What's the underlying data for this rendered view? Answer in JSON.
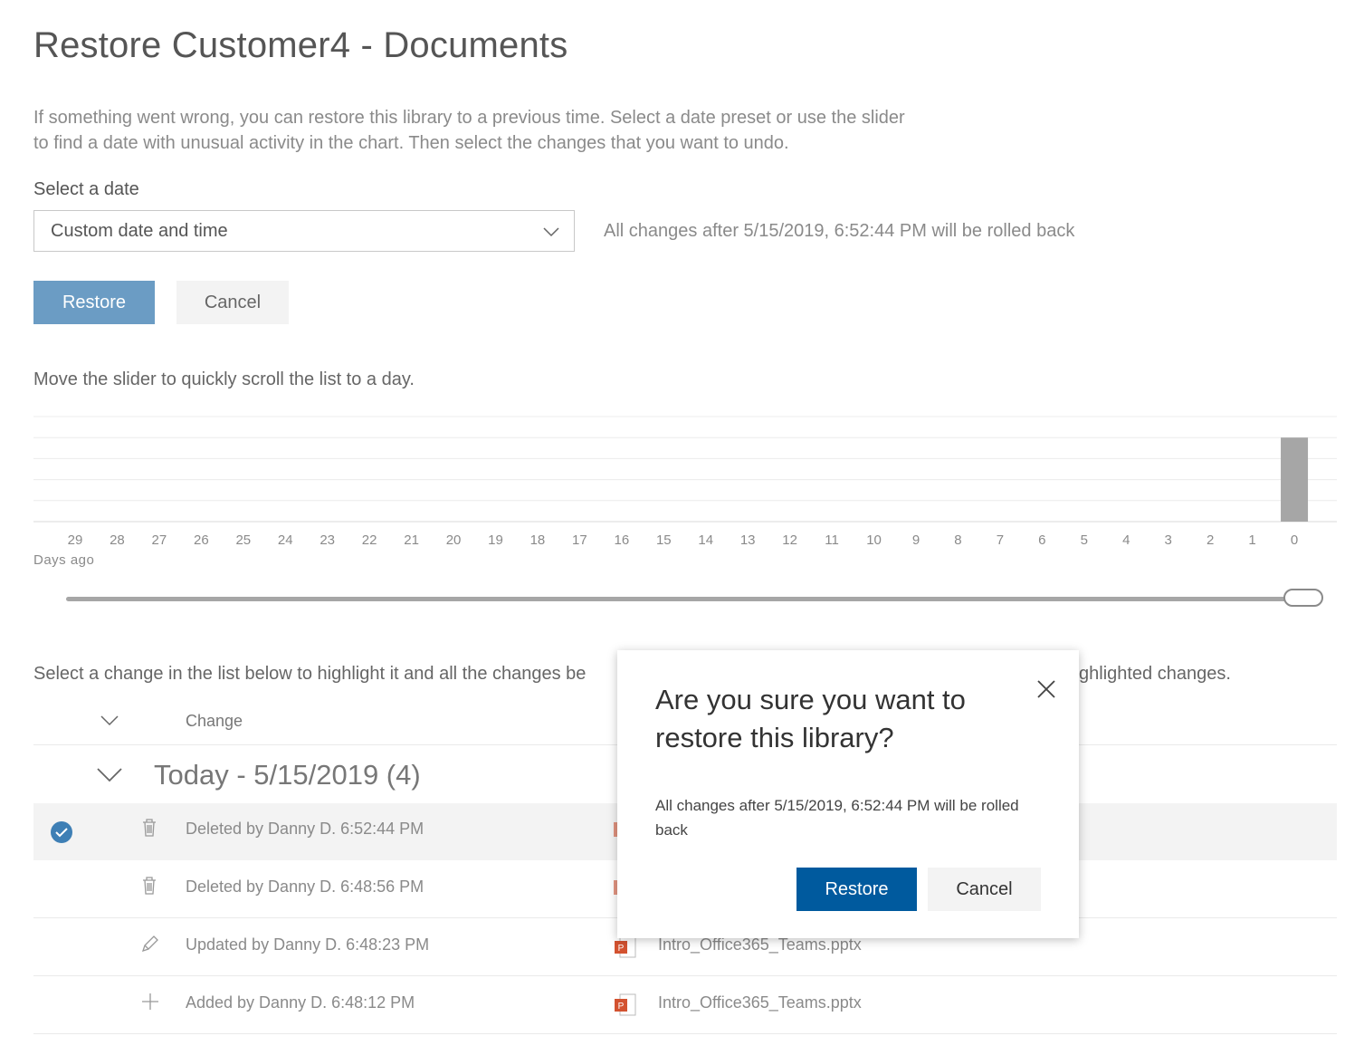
{
  "page": {
    "title": "Restore Customer4 - Documents",
    "description": "If something went wrong, you can restore this library to a previous time. Select a date preset or use the slider to find a date with unusual activity in the chart. Then select the changes that you want to undo."
  },
  "date_select": {
    "label": "Select a date",
    "value": "Custom date and time",
    "rollback_note": "All changes after 5/15/2019, 6:52:44 PM will be rolled back"
  },
  "actions": {
    "restore_label": "Restore",
    "cancel_label": "Cancel"
  },
  "slider": {
    "hint": "Move the slider to quickly scroll the list to a day.",
    "x_label": "Days ago",
    "value": 0
  },
  "chart_data": {
    "type": "bar",
    "categories": [
      "29",
      "28",
      "27",
      "26",
      "25",
      "24",
      "23",
      "22",
      "21",
      "20",
      "19",
      "18",
      "17",
      "16",
      "15",
      "14",
      "13",
      "12",
      "11",
      "10",
      "9",
      "8",
      "7",
      "6",
      "5",
      "4",
      "3",
      "2",
      "1",
      "0"
    ],
    "values": [
      0,
      0,
      0,
      0,
      0,
      0,
      0,
      0,
      0,
      0,
      0,
      0,
      0,
      0,
      0,
      0,
      0,
      0,
      0,
      0,
      0,
      0,
      0,
      0,
      0,
      0,
      0,
      0,
      0,
      4
    ],
    "xlabel": "Days ago",
    "ylabel": "",
    "ylim": [
      0,
      5
    ],
    "grid": true,
    "bar_color": "#a6a6a6"
  },
  "changes": {
    "hint": "Select a change in the list below to highlight it and all the changes be",
    "hint_tail": "ghlighted changes.",
    "column_change": "Change",
    "group_title": "Today - 5/15/2019 (4)",
    "rows": [
      {
        "icon": "trash-icon",
        "text": "Deleted by Danny D. 6:52:44 PM",
        "file": "",
        "selected": true
      },
      {
        "icon": "trash-icon",
        "text": "Deleted by Danny D. 6:48:56 PM",
        "file": "",
        "selected": false
      },
      {
        "icon": "pencil-icon",
        "text": "Updated by Danny D. 6:48:23 PM",
        "file": "Intro_Office365_Teams.pptx",
        "selected": false
      },
      {
        "icon": "plus-icon",
        "text": "Added by Danny D. 6:48:12 PM",
        "file": "Intro_Office365_Teams.pptx",
        "selected": false
      }
    ]
  },
  "dialog": {
    "title": "Are you sure you want to restore this library?",
    "body": "All changes after 5/15/2019, 6:52:44 PM will be rolled back",
    "restore_label": "Restore",
    "cancel_label": "Cancel"
  },
  "colors": {
    "accent_disabled": "#6b9cc4",
    "accent": "#005a9e",
    "selected_check": "#3e7fb5"
  }
}
